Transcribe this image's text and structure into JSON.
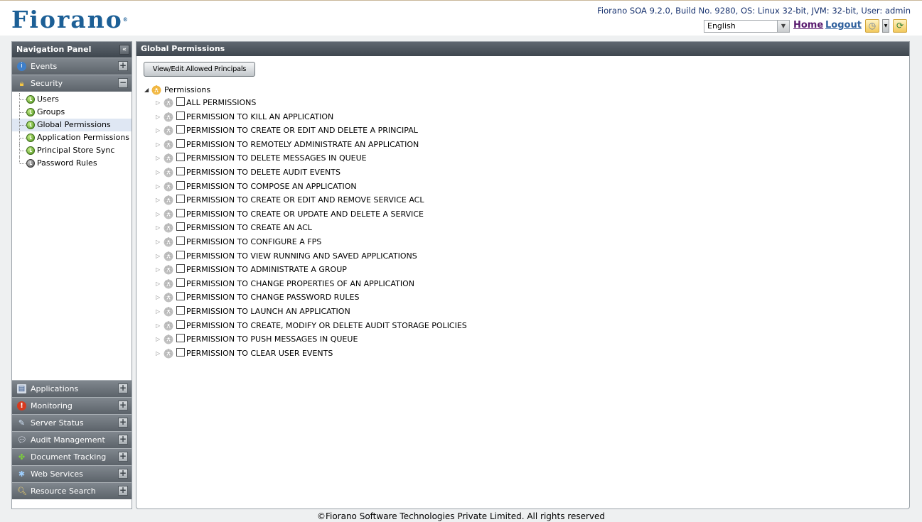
{
  "header": {
    "logo_text": "Fiorano",
    "build_info": "Fiorano SOA 9.2.0, Build No. 9280, OS: Linux 32-bit, JVM: 32-bit, User: admin",
    "language": "English",
    "home_label": "Home",
    "logout_label": "Logout"
  },
  "nav": {
    "title": "Navigation Panel",
    "events": "Events",
    "security": "Security",
    "security_items": [
      {
        "label": "Users",
        "status": "green"
      },
      {
        "label": "Groups",
        "status": "green"
      },
      {
        "label": "Global Permissions",
        "status": "green"
      },
      {
        "label": "Application Permissions",
        "status": "green"
      },
      {
        "label": "Principal Store Sync",
        "status": "green"
      },
      {
        "label": "Password Rules",
        "status": "gray"
      }
    ],
    "bottom_sections": [
      {
        "label": "Applications",
        "icon": "applications-icon"
      },
      {
        "label": "Monitoring",
        "icon": "monitoring-icon"
      },
      {
        "label": "Server Status",
        "icon": "server-status-icon"
      },
      {
        "label": "Audit Management",
        "icon": "audit-icon"
      },
      {
        "label": "Document Tracking",
        "icon": "document-tracking-icon"
      },
      {
        "label": "Web Services",
        "icon": "web-services-icon"
      },
      {
        "label": "Resource Search",
        "icon": "resource-search-icon"
      }
    ]
  },
  "main": {
    "title": "Global Permissions",
    "view_edit_button": "View/Edit Allowed Principals",
    "tree_root": "Permissions",
    "permissions": [
      "ALL PERMISSIONS",
      "PERMISSION TO KILL AN APPLICATION",
      "PERMISSION TO CREATE OR EDIT AND DELETE A PRINCIPAL",
      "PERMISSION TO REMOTELY ADMINISTRATE AN APPLICATION",
      "PERMISSION TO DELETE MESSAGES IN QUEUE",
      "PERMISSION TO DELETE AUDIT EVENTS",
      "PERMISSION TO COMPOSE AN APPLICATION",
      "PERMISSION TO CREATE OR EDIT AND REMOVE SERVICE ACL",
      "PERMISSION TO CREATE OR UPDATE AND DELETE A SERVICE",
      "PERMISSION TO CREATE AN ACL",
      "PERMISSION TO CONFIGURE A FPS",
      "PERMISSION TO VIEW RUNNING AND SAVED APPLICATIONS",
      "PERMISSION TO ADMINISTRATE A GROUP",
      "PERMISSION TO CHANGE PROPERTIES OF AN APPLICATION",
      "PERMISSION TO CHANGE PASSWORD RULES",
      "PERMISSION TO LAUNCH AN APPLICATION",
      "PERMISSION TO CREATE, MODIFY OR DELETE AUDIT STORAGE POLICIES",
      "PERMISSION TO PUSH MESSAGES IN QUEUE",
      "PERMISSION TO CLEAR USER EVENTS"
    ]
  },
  "footer": {
    "text": "©Fiorano Software Technologies Private Limited. All rights reserved"
  }
}
